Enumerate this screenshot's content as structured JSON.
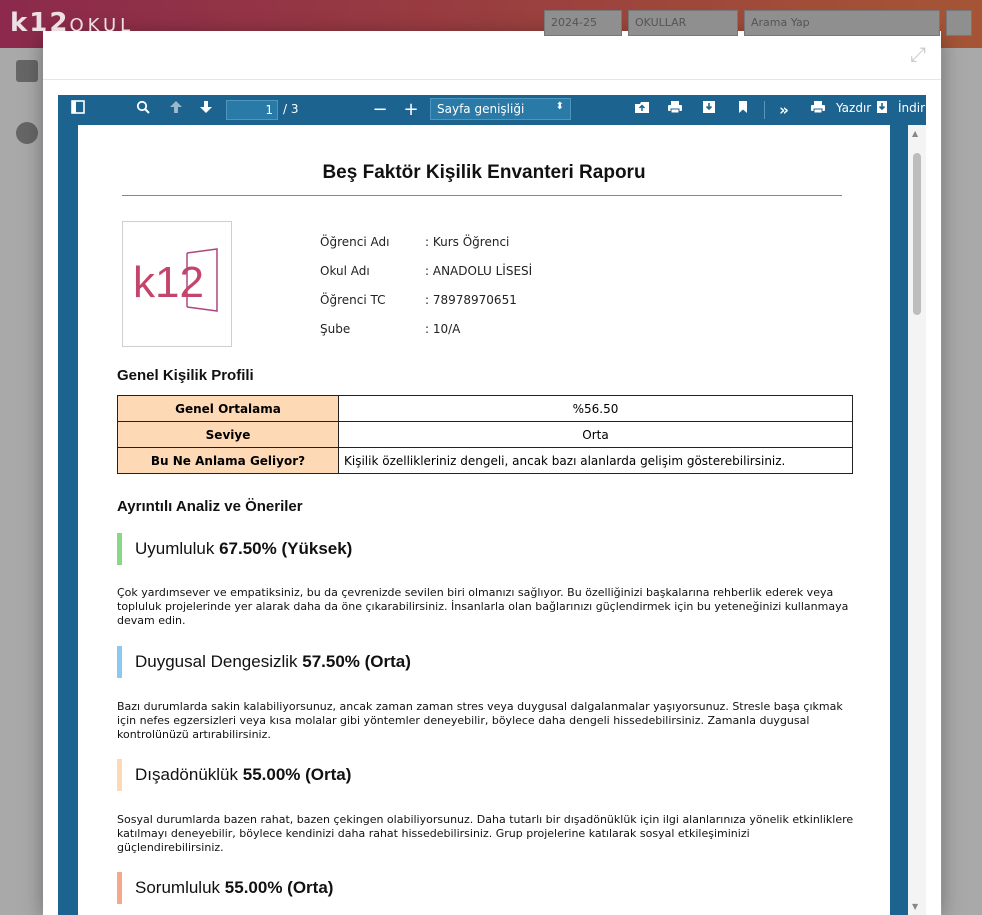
{
  "app": {
    "logo_main": "k12",
    "logo_sub": "OKUL",
    "year": "2024-25",
    "school_filter": "OKULLAR",
    "search_placeholder": "Arama Yap"
  },
  "viewer": {
    "page_current": "1",
    "page_total": "/ 3",
    "zoom": "Sayfa genişliği",
    "print_label": "Yazdır",
    "download_label": "İndir"
  },
  "report": {
    "title": "Beş Faktör Kişilik Envanteri Raporu",
    "logo_text": "k12",
    "info": [
      {
        "label": "Öğrenci Adı",
        "value": ": Kurs Öğrenci"
      },
      {
        "label": "Okul Adı",
        "value": ": ANADOLU LİSESİ"
      },
      {
        "label": "Öğrenci TC",
        "value": ": 78978970651"
      },
      {
        "label": "Şube",
        "value": ": 10/A"
      }
    ],
    "profile_heading": "Genel Kişilik Profili",
    "profile": [
      {
        "key": "Genel Ortalama",
        "value": "%56.50"
      },
      {
        "key": "Seviye",
        "value": "Orta"
      },
      {
        "key": "Bu Ne Anlama Geliyor?",
        "value": "Kişilik özellikleriniz dengeli, ancak bazı alanlarda gelişim gösterebilirsiniz."
      }
    ],
    "analysis_heading": "Ayrıntılı Analiz ve Öneriler",
    "traits": [
      {
        "name": "Uyumluluk",
        "score": "67.50% (Yüksek)",
        "color": "#8ad886",
        "lines": [
          "Çok yardımsever ve empatiksiniz, bu da çevrenizde sevilen biri olmanızı sağlıyor. Bu özelliğinizi başkalarına rehberlik ederek veya",
          "topluluk projelerinde yer alarak daha da öne çıkarabilirsiniz. İnsanlarla olan bağlarınızı güçlendirmek için bu yeteneğinizi kullanmaya",
          "devam edin."
        ]
      },
      {
        "name": "Duygusal Dengesizlik",
        "score": "57.50% (Orta)",
        "color": "#8cc8f0",
        "lines": [
          "Bazı durumlarda sakin kalabiliyorsunuz, ancak zaman zaman stres veya duygusal dalgalanmalar yaşıyorsunuz. Stresle başa çıkmak",
          "için nefes egzersizleri veya kısa molalar gibi yöntemler deneyebilir, böylece daha dengeli hissedebilirsiniz. Zamanla duygusal",
          "kontrolünüzü artırabilirsiniz."
        ]
      },
      {
        "name": "Dışadönüklük",
        "score": "55.00% (Orta)",
        "color": "#fdd9b5",
        "lines": [
          "Sosyal durumlarda bazen rahat, bazen çekingen olabiliyorsunuz. Daha tutarlı bir dışadönüklük için ilgi alanlarınıza yönelik etkinliklere",
          "katılmayı deneyebilir, böylece kendinizi daha rahat hissedebilirsiniz. Grup projelerine katılarak sosyal etkileşiminizi",
          "güçlendirebilirsiniz."
        ]
      },
      {
        "name": "Sorumluluk",
        "score": "55.00% (Orta)",
        "color": "#f5a88a",
        "lines": []
      }
    ]
  }
}
